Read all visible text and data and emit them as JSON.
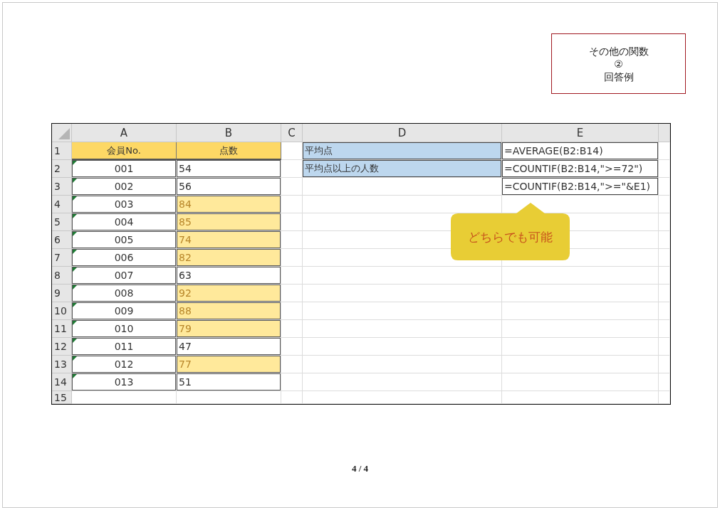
{
  "title_box": {
    "lines": [
      "その他の関数",
      "②",
      "回答例"
    ]
  },
  "sheet": {
    "columns": [
      "A",
      "B",
      "C",
      "D",
      "E"
    ],
    "rows": [
      {
        "number": "1",
        "cells": [
          {
            "kind": "header",
            "text": "会員No."
          },
          {
            "kind": "header",
            "text": "点数"
          },
          {
            "kind": "empty"
          },
          {
            "kind": "label",
            "text": "平均点"
          },
          {
            "kind": "formula",
            "text": "=AVERAGE(B2:B14)"
          }
        ]
      },
      {
        "number": "2",
        "cells": [
          {
            "kind": "id",
            "text": "001"
          },
          {
            "kind": "score",
            "text": "54",
            "highlighted": false
          },
          {
            "kind": "empty"
          },
          {
            "kind": "label",
            "text": "平均点以上の人数"
          },
          {
            "kind": "formula",
            "text": "=COUNTIF(B2:B14,\">=72\")"
          }
        ]
      },
      {
        "number": "3",
        "cells": [
          {
            "kind": "id",
            "text": "002"
          },
          {
            "kind": "score",
            "text": "56",
            "highlighted": false
          },
          {
            "kind": "empty"
          },
          {
            "kind": "empty"
          },
          {
            "kind": "formula",
            "text": "=COUNTIF(B2:B14,\">=\"&E1)"
          }
        ]
      },
      {
        "number": "4",
        "cells": [
          {
            "kind": "id",
            "text": "003"
          },
          {
            "kind": "score",
            "text": "84",
            "highlighted": true
          },
          {
            "kind": "empty"
          },
          {
            "kind": "empty"
          },
          {
            "kind": "empty"
          }
        ]
      },
      {
        "number": "5",
        "cells": [
          {
            "kind": "id",
            "text": "004"
          },
          {
            "kind": "score",
            "text": "85",
            "highlighted": true
          },
          {
            "kind": "empty"
          },
          {
            "kind": "empty"
          },
          {
            "kind": "empty"
          }
        ]
      },
      {
        "number": "6",
        "cells": [
          {
            "kind": "id",
            "text": "005"
          },
          {
            "kind": "score",
            "text": "74",
            "highlighted": true
          },
          {
            "kind": "empty"
          },
          {
            "kind": "empty"
          },
          {
            "kind": "empty"
          }
        ]
      },
      {
        "number": "7",
        "cells": [
          {
            "kind": "id",
            "text": "006"
          },
          {
            "kind": "score",
            "text": "82",
            "highlighted": true
          },
          {
            "kind": "empty"
          },
          {
            "kind": "empty"
          },
          {
            "kind": "empty"
          }
        ]
      },
      {
        "number": "8",
        "cells": [
          {
            "kind": "id",
            "text": "007"
          },
          {
            "kind": "score",
            "text": "63",
            "highlighted": false
          },
          {
            "kind": "empty"
          },
          {
            "kind": "empty"
          },
          {
            "kind": "empty"
          }
        ]
      },
      {
        "number": "9",
        "cells": [
          {
            "kind": "id",
            "text": "008"
          },
          {
            "kind": "score",
            "text": "92",
            "highlighted": true
          },
          {
            "kind": "empty"
          },
          {
            "kind": "empty"
          },
          {
            "kind": "empty"
          }
        ]
      },
      {
        "number": "10",
        "cells": [
          {
            "kind": "id",
            "text": "009"
          },
          {
            "kind": "score",
            "text": "88",
            "highlighted": true
          },
          {
            "kind": "empty"
          },
          {
            "kind": "empty"
          },
          {
            "kind": "empty"
          }
        ]
      },
      {
        "number": "11",
        "cells": [
          {
            "kind": "id",
            "text": "010"
          },
          {
            "kind": "score",
            "text": "79",
            "highlighted": true
          },
          {
            "kind": "empty"
          },
          {
            "kind": "empty"
          },
          {
            "kind": "empty"
          }
        ]
      },
      {
        "number": "12",
        "cells": [
          {
            "kind": "id",
            "text": "011"
          },
          {
            "kind": "score",
            "text": "47",
            "highlighted": false
          },
          {
            "kind": "empty"
          },
          {
            "kind": "empty"
          },
          {
            "kind": "empty"
          }
        ]
      },
      {
        "number": "13",
        "cells": [
          {
            "kind": "id",
            "text": "012"
          },
          {
            "kind": "score",
            "text": "77",
            "highlighted": true
          },
          {
            "kind": "empty"
          },
          {
            "kind": "empty"
          },
          {
            "kind": "empty"
          }
        ]
      },
      {
        "number": "14",
        "cells": [
          {
            "kind": "id",
            "text": "013"
          },
          {
            "kind": "score",
            "text": "51",
            "highlighted": false
          },
          {
            "kind": "empty"
          },
          {
            "kind": "empty"
          },
          {
            "kind": "empty"
          }
        ]
      },
      {
        "number": "15",
        "cells": [
          {
            "kind": "empty"
          },
          {
            "kind": "empty"
          },
          {
            "kind": "empty"
          },
          {
            "kind": "empty"
          },
          {
            "kind": "empty"
          }
        ]
      }
    ]
  },
  "callout": {
    "text": "どちらでも可能"
  },
  "page_number": "4 / 4"
}
